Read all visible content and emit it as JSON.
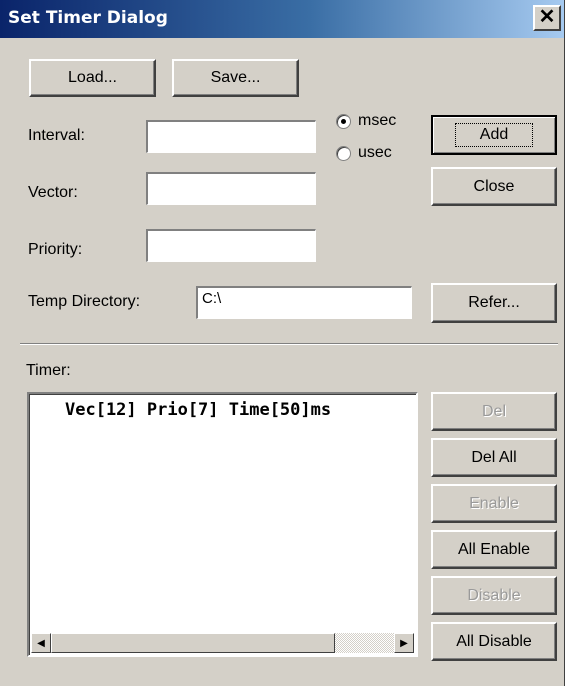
{
  "window": {
    "title": "Set Timer Dialog",
    "close_glyph": "✕"
  },
  "buttons": {
    "load": "Load...",
    "save": "Save...",
    "add": "Add",
    "close": "Close",
    "refer": "Refer...",
    "del": "Del",
    "del_all": "Del All",
    "enable": "Enable",
    "all_enable": "All Enable",
    "disable": "Disable",
    "all_disable": "All Disable"
  },
  "fields": {
    "interval": {
      "label": "Interval:",
      "value": ""
    },
    "vector": {
      "label": "Vector:",
      "value": ""
    },
    "priority": {
      "label": "Priority:",
      "value": ""
    },
    "temp_directory": {
      "label": "Temp Directory:",
      "value": "C:\\"
    }
  },
  "units": {
    "options": [
      "msec",
      "usec"
    ],
    "selected": "msec"
  },
  "timer": {
    "label": "Timer:",
    "items": [
      "Vec[12] Prio[7] Time[50]ms"
    ]
  }
}
